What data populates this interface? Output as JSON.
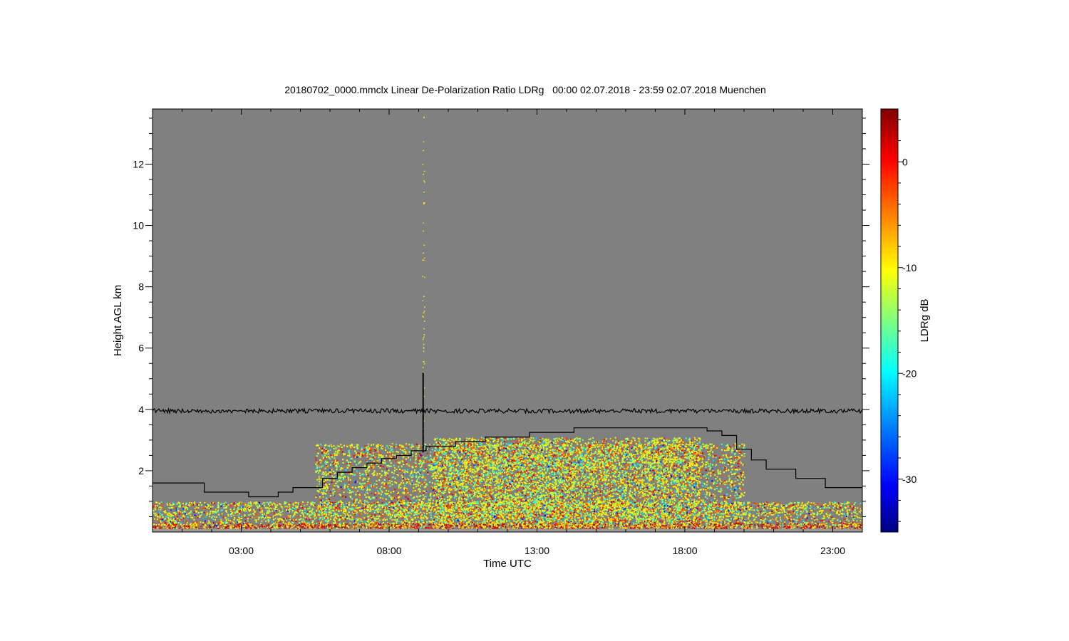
{
  "chart_data": {
    "type": "heatmap",
    "title": "20180702_0000.mmclx Linear De-Polarization Ratio LDRg   00:00 02.07.2018 - 23:59 02.07.2018 Muenchen",
    "xlabel": "Time UTC",
    "ylabel": "Height AGL km",
    "x_unit": "hours UTC",
    "xlim": [
      0,
      24
    ],
    "ylim": [
      0,
      13.8
    ],
    "x_ticks": [
      {
        "value": 3,
        "label": "03:00"
      },
      {
        "value": 8,
        "label": "08:00"
      },
      {
        "value": 13,
        "label": "13:00"
      },
      {
        "value": 18,
        "label": "18:00"
      },
      {
        "value": 23,
        "label": "23:00"
      }
    ],
    "y_ticks": [
      {
        "value": 2,
        "label": "2"
      },
      {
        "value": 4,
        "label": "4"
      },
      {
        "value": 6,
        "label": "6"
      },
      {
        "value": 8,
        "label": "8"
      },
      {
        "value": 10,
        "label": "10"
      },
      {
        "value": 12,
        "label": "12"
      }
    ],
    "background_color": "#808080",
    "colorbar": {
      "label": "LDRg dB",
      "range": [
        -35,
        5
      ],
      "ticks": [
        {
          "value": 0,
          "label": "0"
        },
        {
          "value": -10,
          "label": "-10"
        },
        {
          "value": -20,
          "label": "-20"
        },
        {
          "value": -30,
          "label": "-30"
        }
      ],
      "colormap": [
        "#00007f",
        "#0000ff",
        "#0080ff",
        "#00ffff",
        "#80ff80",
        "#ffff00",
        "#ff8000",
        "#ff0000",
        "#7f0000"
      ]
    },
    "series": [
      {
        "type": "step",
        "color": "#000000",
        "points": [
          [
            0,
            1.6
          ],
          [
            1.75,
            1.3
          ],
          [
            3.25,
            1.15
          ],
          [
            4.25,
            1.3
          ],
          [
            4.75,
            1.45
          ],
          [
            5.75,
            1.75
          ],
          [
            6.25,
            1.95
          ],
          [
            6.75,
            2.1
          ],
          [
            7.25,
            2.25
          ],
          [
            7.75,
            2.4
          ],
          [
            8.25,
            2.5
          ],
          [
            8.75,
            2.65
          ],
          [
            9.25,
            2.8
          ],
          [
            10.25,
            2.95
          ],
          [
            11.25,
            3.1
          ],
          [
            12.75,
            3.25
          ],
          [
            14.25,
            3.4
          ],
          [
            18.75,
            3.3
          ],
          [
            19.25,
            3.15
          ],
          [
            19.75,
            2.7
          ],
          [
            20.25,
            2.35
          ],
          [
            20.75,
            2.05
          ],
          [
            21.75,
            1.75
          ],
          [
            22.75,
            1.45
          ],
          [
            24,
            1.45
          ]
        ]
      },
      {
        "type": "line",
        "color": "#000000",
        "height_km": 3.95
      }
    ],
    "spike": {
      "time_h": 9.15,
      "top_km": 5.2
    },
    "echo_regions": [
      {
        "x0": 0,
        "x1": 24,
        "top_km": 1.0,
        "dominant_db": -10
      },
      {
        "x0": 5.5,
        "x1": 20,
        "top_km": 2.9,
        "dominant_db": -10
      },
      {
        "x0": 9.5,
        "x1": 18.5,
        "top_km": 3.1,
        "dominant_db": -12
      }
    ]
  }
}
